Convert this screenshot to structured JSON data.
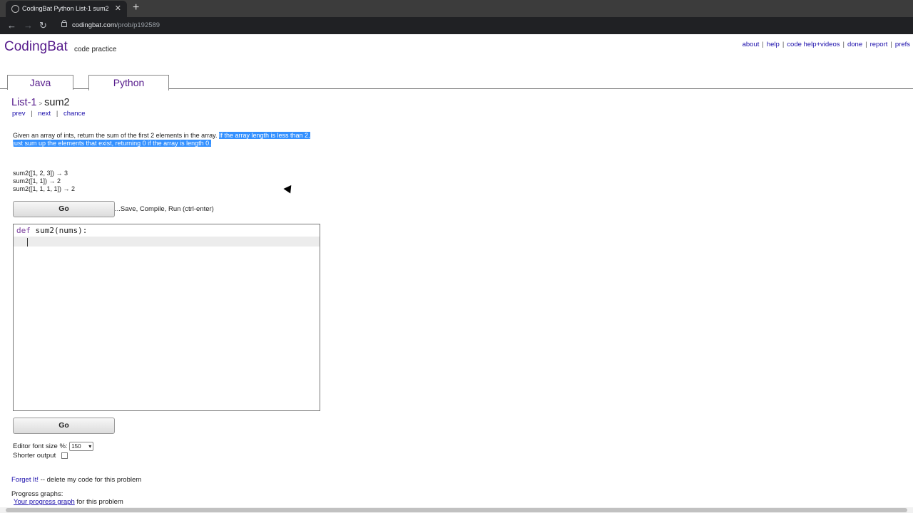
{
  "browser": {
    "tab_title": "CodingBat Python List-1 sum2",
    "url_host": "codingbat.com",
    "url_path": "/prob/p192589"
  },
  "site": {
    "brand": "CodingBat",
    "brand_sub": "code practice",
    "top_links": [
      "about",
      "help",
      "code help+videos",
      "done",
      "report",
      "prefs"
    ]
  },
  "tabs": [
    "Java",
    "Python"
  ],
  "problem": {
    "section": "List-1",
    "name": "sum2",
    "nav": [
      "prev",
      "next",
      "chance"
    ],
    "description_plain": "Given an array of ints, return the sum of the first 2 elements in the array. ",
    "description_selected": "If the array length is less than 2, just sum up the elements that exist, returning 0 if the array is length 0.",
    "examples": [
      "sum2([1, 2, 3]) → 3",
      "sum2([1, 1]) → 2",
      "sum2([1, 1, 1, 1]) → 2"
    ]
  },
  "controls": {
    "go_label": "Go",
    "go_hint": "...Save, Compile, Run (ctrl-enter)",
    "code_keyword": "def",
    "code_rest": " sum2(nums):",
    "font_size_label": "Editor font size %:",
    "font_size_value": "150",
    "shorter_label": "Shorter output",
    "forget_link": "Forget It!",
    "forget_text": " -- delete my code for this problem",
    "progress_label": "Progress graphs:",
    "progress_link": "Your progress graph",
    "progress_text": " for this problem"
  }
}
